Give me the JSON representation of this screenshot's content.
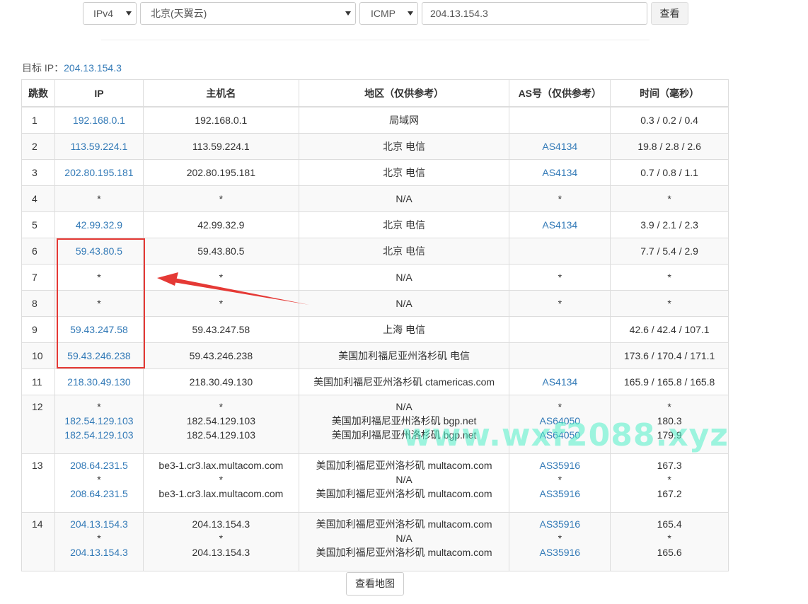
{
  "query": {
    "ip_version": "IPv4",
    "node": "北京(天翼云)",
    "protocol": "ICMP",
    "target_input": "204.13.154.3",
    "query_button": "查看"
  },
  "target_label": "目标 IP：",
  "target_ip": "204.13.154.3",
  "table": {
    "headers": [
      "跳数",
      "IP",
      "主机名",
      "地区（仅供参考）",
      "AS号（仅供参考）",
      "时间（毫秒）"
    ],
    "rows": [
      {
        "hop": "1",
        "ip": [
          "192.168.0.1"
        ],
        "host": [
          "192.168.0.1"
        ],
        "region": [
          "局域网"
        ],
        "as": [
          ""
        ],
        "time": [
          "0.3 / 0.2 / 0.4"
        ]
      },
      {
        "hop": "2",
        "ip": [
          "113.59.224.1"
        ],
        "host": [
          "113.59.224.1"
        ],
        "region": [
          "北京 电信"
        ],
        "as": [
          "AS4134"
        ],
        "time": [
          "19.8 / 2.8 / 2.6"
        ]
      },
      {
        "hop": "3",
        "ip": [
          "202.80.195.181"
        ],
        "host": [
          "202.80.195.181"
        ],
        "region": [
          "北京 电信"
        ],
        "as": [
          "AS4134"
        ],
        "time": [
          "0.7 / 0.8 / 1.1"
        ]
      },
      {
        "hop": "4",
        "ip": [
          "*"
        ],
        "host": [
          "*"
        ],
        "region": [
          "N/A"
        ],
        "as": [
          "*"
        ],
        "time": [
          "*"
        ]
      },
      {
        "hop": "5",
        "ip": [
          "42.99.32.9"
        ],
        "host": [
          "42.99.32.9"
        ],
        "region": [
          "北京 电信"
        ],
        "as": [
          "AS4134"
        ],
        "time": [
          "3.9 / 2.1 / 2.3"
        ]
      },
      {
        "hop": "6",
        "ip": [
          "59.43.80.5"
        ],
        "host": [
          "59.43.80.5"
        ],
        "region": [
          "北京 电信"
        ],
        "as": [
          ""
        ],
        "time": [
          "7.7 / 5.4 / 2.9"
        ]
      },
      {
        "hop": "7",
        "ip": [
          "*"
        ],
        "host": [
          "*"
        ],
        "region": [
          "N/A"
        ],
        "as": [
          "*"
        ],
        "time": [
          "*"
        ]
      },
      {
        "hop": "8",
        "ip": [
          "*"
        ],
        "host": [
          "*"
        ],
        "region": [
          "N/A"
        ],
        "as": [
          "*"
        ],
        "time": [
          "*"
        ]
      },
      {
        "hop": "9",
        "ip": [
          "59.43.247.58"
        ],
        "host": [
          "59.43.247.58"
        ],
        "region": [
          "上海 电信"
        ],
        "as": [
          ""
        ],
        "time": [
          "42.6 / 42.4 / 107.1"
        ]
      },
      {
        "hop": "10",
        "ip": [
          "59.43.246.238"
        ],
        "host": [
          "59.43.246.238"
        ],
        "region": [
          "美国加利福尼亚州洛杉矶 电信"
        ],
        "as": [
          ""
        ],
        "time": [
          "173.6 / 170.4 / 171.1"
        ]
      },
      {
        "hop": "11",
        "ip": [
          "218.30.49.130"
        ],
        "host": [
          "218.30.49.130"
        ],
        "region": [
          "美国加利福尼亚州洛杉矶 ctamericas.com"
        ],
        "as": [
          "AS4134"
        ],
        "time": [
          "165.9 / 165.8 / 165.8"
        ]
      },
      {
        "hop": "12",
        "ip": [
          "*",
          "182.54.129.103",
          "182.54.129.103"
        ],
        "host": [
          "*",
          "182.54.129.103",
          "182.54.129.103"
        ],
        "region": [
          "N/A",
          "美国加利福尼亚州洛杉矶 bgp.net",
          "美国加利福尼亚州洛杉矶 bgp.net"
        ],
        "as": [
          "*",
          "AS64050",
          "AS64050"
        ],
        "time": [
          "*",
          "180.3",
          "179.9"
        ]
      },
      {
        "hop": "13",
        "ip": [
          "208.64.231.5",
          "*",
          "208.64.231.5"
        ],
        "host": [
          "be3-1.cr3.lax.multacom.com",
          "*",
          "be3-1.cr3.lax.multacom.com"
        ],
        "region": [
          "美国加利福尼亚州洛杉矶 multacom.com",
          "N/A",
          "美国加利福尼亚州洛杉矶 multacom.com"
        ],
        "as": [
          "AS35916",
          "*",
          "AS35916"
        ],
        "time": [
          "167.3",
          "*",
          "167.2"
        ]
      },
      {
        "hop": "14",
        "ip": [
          "204.13.154.3",
          "*",
          "204.13.154.3"
        ],
        "host": [
          "204.13.154.3",
          "*",
          "204.13.154.3"
        ],
        "region": [
          "美国加利福尼亚州洛杉矶 multacom.com",
          "N/A",
          "美国加利福尼亚州洛杉矶 multacom.com"
        ],
        "as": [
          "AS35916",
          "*",
          "AS35916"
        ],
        "time": [
          "165.4",
          "*",
          "165.6"
        ]
      }
    ]
  },
  "map_button": "查看地图",
  "watermark": "www.wxf2088.xyz",
  "colors": {
    "link": "#337ab7",
    "highlight": "#e53935",
    "watermark": "#50f0c8"
  }
}
